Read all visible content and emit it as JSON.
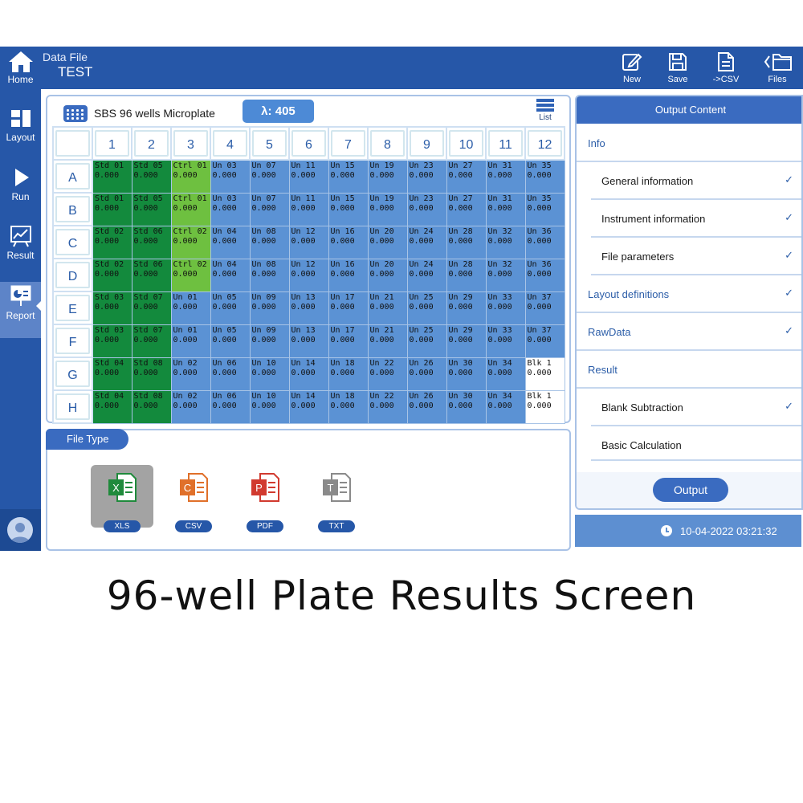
{
  "topbar": {
    "home_label": "Home",
    "file_caption": "Data File",
    "file_name": "TEST",
    "tools": [
      {
        "label": "New",
        "icon": "edit-icon"
      },
      {
        "label": "Save",
        "icon": "save-icon"
      },
      {
        "label": "->CSV",
        "icon": "export-csv-icon"
      },
      {
        "label": "Files",
        "icon": "folder-icon"
      }
    ]
  },
  "sidebar": {
    "items": [
      {
        "label": "Layout",
        "icon": "layout-icon"
      },
      {
        "label": "Run",
        "icon": "play-icon"
      },
      {
        "label": "Result",
        "icon": "chart-icon"
      },
      {
        "label": "Report",
        "icon": "report-icon",
        "active": true
      }
    ]
  },
  "plate": {
    "title": "SBS 96 wells Microplate",
    "wavelength": "λ: 405",
    "list_label": "List",
    "columns": [
      "1",
      "2",
      "3",
      "4",
      "5",
      "6",
      "7",
      "8",
      "9",
      "10",
      "11",
      "12"
    ],
    "rows": [
      "A",
      "B",
      "C",
      "D",
      "E",
      "F",
      "G",
      "H"
    ],
    "cells": [
      [
        "Std 01",
        "Std 05",
        "Ctrl 01",
        "Un 03",
        "Un 07",
        "Un 11",
        "Un 15",
        "Un 19",
        "Un 23",
        "Un 27",
        "Un 31",
        "Un 35"
      ],
      [
        "Std 01",
        "Std 05",
        "Ctrl 01",
        "Un 03",
        "Un 07",
        "Un 11",
        "Un 15",
        "Un 19",
        "Un 23",
        "Un 27",
        "Un 31",
        "Un 35"
      ],
      [
        "Std 02",
        "Std 06",
        "Ctrl 02",
        "Un 04",
        "Un 08",
        "Un 12",
        "Un 16",
        "Un 20",
        "Un 24",
        "Un 28",
        "Un 32",
        "Un 36"
      ],
      [
        "Std 02",
        "Std 06",
        "Ctrl 02",
        "Un 04",
        "Un 08",
        "Un 12",
        "Un 16",
        "Un 20",
        "Un 24",
        "Un 28",
        "Un 32",
        "Un 36"
      ],
      [
        "Std 03",
        "Std 07",
        "Un 01",
        "Un 05",
        "Un 09",
        "Un 13",
        "Un 17",
        "Un 21",
        "Un 25",
        "Un 29",
        "Un 33",
        "Un 37"
      ],
      [
        "Std 03",
        "Std 07",
        "Un 01",
        "Un 05",
        "Un 09",
        "Un 13",
        "Un 17",
        "Un 21",
        "Un 25",
        "Un 29",
        "Un 33",
        "Un 37"
      ],
      [
        "Std 04",
        "Std 08",
        "Un 02",
        "Un 06",
        "Un 10",
        "Un 14",
        "Un 18",
        "Un 22",
        "Un 26",
        "Un 30",
        "Un 34",
        "Blk 1"
      ],
      [
        "Std 04",
        "Std 08",
        "Un 02",
        "Un 06",
        "Un 10",
        "Un 14",
        "Un 18",
        "Un 22",
        "Un 26",
        "Un 30",
        "Un 34",
        "Blk 1"
      ]
    ],
    "cell_value": "0.000",
    "colors": {
      "std": "#138a3d",
      "ctrl": "#6ec040",
      "un": "#5b92d4",
      "blk": "#ffffff"
    }
  },
  "file_type": {
    "title": "File Type",
    "options": [
      {
        "label": "XLS",
        "letter": "X",
        "color": "#1f8a3c",
        "selected": true
      },
      {
        "label": "CSV",
        "letter": "C",
        "color": "#e0702a",
        "selected": false
      },
      {
        "label": "PDF",
        "letter": "P",
        "color": "#d13a2f",
        "selected": false
      },
      {
        "label": "TXT",
        "letter": "T",
        "color": "#8a8a8a",
        "selected": false
      }
    ]
  },
  "output": {
    "title": "Output Content",
    "items": [
      {
        "label": "Info",
        "level": "top",
        "checked": false
      },
      {
        "label": "General information",
        "level": "sub",
        "checked": true
      },
      {
        "label": "Instrument information",
        "level": "sub",
        "checked": true
      },
      {
        "label": "File parameters",
        "level": "sub",
        "checked": true
      },
      {
        "label": "Layout definitions",
        "level": "top",
        "checked": true
      },
      {
        "label": "RawData",
        "level": "top",
        "checked": true
      },
      {
        "label": "Result",
        "level": "top",
        "checked": false
      },
      {
        "label": "Blank Subtraction",
        "level": "sub",
        "checked": true
      },
      {
        "label": "Basic Calculation",
        "level": "sub",
        "checked": false
      }
    ],
    "button_label": "Output",
    "check_mark": "✓"
  },
  "status": {
    "datetime": "10-04-2022 03:21:32"
  },
  "caption": "96-well Plate Results Screen"
}
